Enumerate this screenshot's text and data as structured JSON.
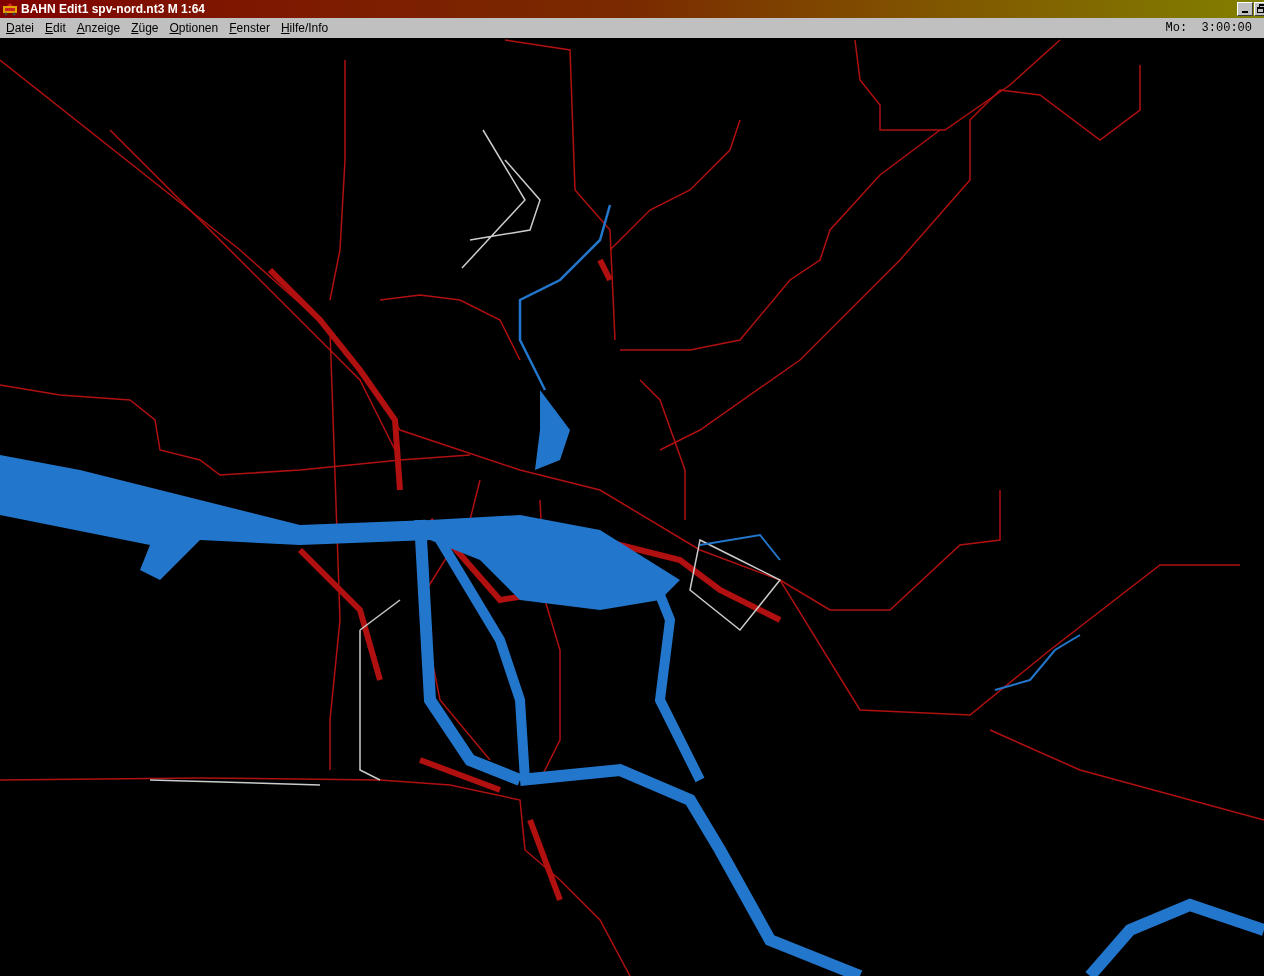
{
  "window": {
    "title": "BAHN Edit1 spv-nord.nt3 M 1:64"
  },
  "menu": [
    {
      "label": "Datei"
    },
    {
      "label": "Edit"
    },
    {
      "label": "Anzeige"
    },
    {
      "label": "Züge"
    },
    {
      "label": "Optionen"
    },
    {
      "label": "Fenster"
    },
    {
      "label": "Hilfe/Info"
    }
  ],
  "clock": "Mo:  3:00:00"
}
